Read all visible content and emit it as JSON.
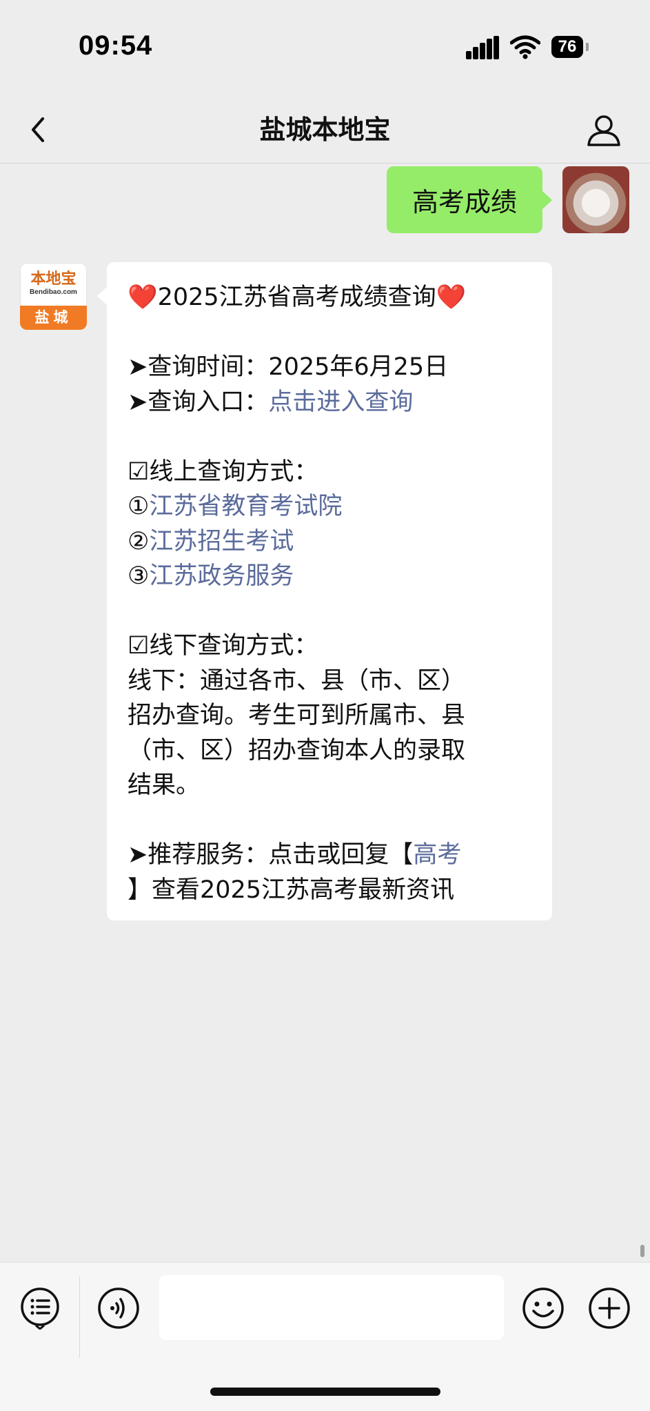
{
  "status_bar": {
    "time": "09:54",
    "battery_level": "76",
    "icons": [
      "signal-icon",
      "wifi-icon",
      "battery-icon"
    ]
  },
  "nav": {
    "title": "盐城本地宝",
    "icons": [
      "back-icon",
      "profile-icon"
    ]
  },
  "user_message": {
    "text": "高考成绩",
    "bubble_color": "#95ec69"
  },
  "bot_avatar": {
    "logo_text": "本地宝",
    "logo_sub": "Bendibao.com",
    "city": "盐城",
    "accent": "#f07b24"
  },
  "bot_message": {
    "title": "2025江苏省高考成绩查询",
    "title_emoji": "❤️",
    "time_label": "➤查询时间：",
    "time_value": "2025年6月25日",
    "entry_label": "➤查询入口：",
    "entry_link": "点击进入查询",
    "online_heading": "☑线上查询方式：",
    "online_items": [
      {
        "num": "①",
        "text": "江苏省教育考试院"
      },
      {
        "num": "②",
        "text": "江苏招生考试"
      },
      {
        "num": "③",
        "text": "江苏政务服务"
      }
    ],
    "offline_heading": "☑线下查询方式：",
    "offline_lines": [
      "线下：通过各市、县（市、区）",
      "招办查询。考生可到所属市、县",
      "（市、区）招办查询本人的录取",
      "结果。"
    ],
    "recommend_prefix": "➤推荐服务：点击或回复【",
    "recommend_link": "高考",
    "recommend_suffix": "】查看2025江苏高考最新资讯",
    "link_color": "#5b6b9b"
  },
  "input_bar": {
    "icons": [
      "menu-icon",
      "voice-icon",
      "emoji-icon",
      "plus-icon"
    ],
    "input_value": ""
  }
}
